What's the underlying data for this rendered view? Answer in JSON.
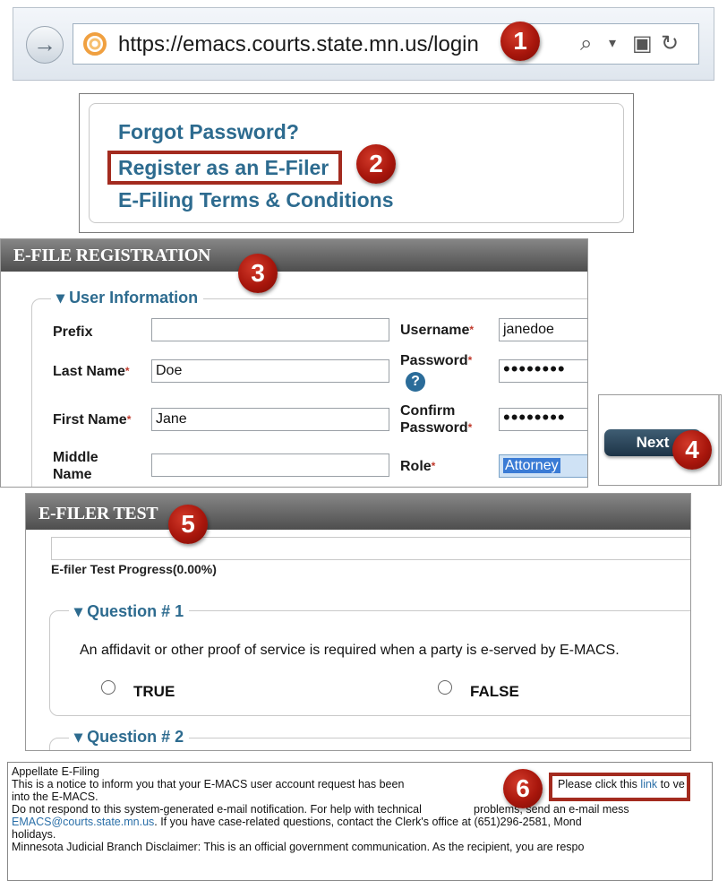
{
  "badges": [
    "1",
    "2",
    "3",
    "4",
    "5",
    "6"
  ],
  "browser": {
    "back_icon": "→",
    "url": "https://emacs.courts.state.mn.us/login",
    "search_icon": "⌕",
    "dropdown_icon": "▾",
    "lock_icon": "▣",
    "refresh_icon": "↻"
  },
  "login_links": {
    "forgot": "Forgot Password?",
    "register": "Register as an E-Filer",
    "terms": "E-Filing Terms & Conditions"
  },
  "registration": {
    "header": "E-FILE REGISTRATION",
    "section": "User Information",
    "fields": {
      "prefix_label": "Prefix",
      "prefix_value": "",
      "last_name_label": "Last Name",
      "last_name_value": "Doe",
      "first_name_label": "First Name",
      "first_name_value": "Jane",
      "middle_name_label_1": "Middle",
      "middle_name_label_2": "Name",
      "middle_name_value": "",
      "username_label": "Username",
      "username_value": "janedoe",
      "password_label": "Password",
      "password_value": "••••••••",
      "confirm_label_1": "Confirm",
      "confirm_label_2": "Password",
      "confirm_value": "••••••••",
      "role_label": "Role",
      "role_value": "Attorney",
      "required_mark": "*",
      "help_icon": "?"
    }
  },
  "next_panel": {
    "next_label": "Next"
  },
  "efiler_test": {
    "header": "E-FILER TEST",
    "progress_label": "E-filer Test Progress(0.00%)",
    "progress_value": 0,
    "question1": {
      "legend": "Question # 1",
      "text": "An affidavit or other proof of service is required when a party is e-served by E-MACS.",
      "option_true": "TRUE",
      "option_false": "FALSE"
    },
    "question2": {
      "legend": "Question # 2"
    },
    "collapse_icon": "▾"
  },
  "email": {
    "line1": "Appellate E-Filing",
    "line2a": "This is a notice to inform you that your E-MACS user account request has been",
    "line2b": "Please click this",
    "line2_link": "link",
    "line2c": "to ve",
    "line3": "into the E-MACS.",
    "line4a": "Do not respond to this system-generated e-mail notification. For help with technical",
    "line4b": "problems, send an e-mail mess",
    "line5_link": "EMACS@courts.state.mn.us",
    "line5": ". If you have case-related questions, contact the Clerk's office at (651)296-2581, Mond",
    "line6": "holidays.",
    "line7": "Minnesota Judicial Branch Disclaimer: This is an official government communication. As the recipient, you are respo"
  }
}
